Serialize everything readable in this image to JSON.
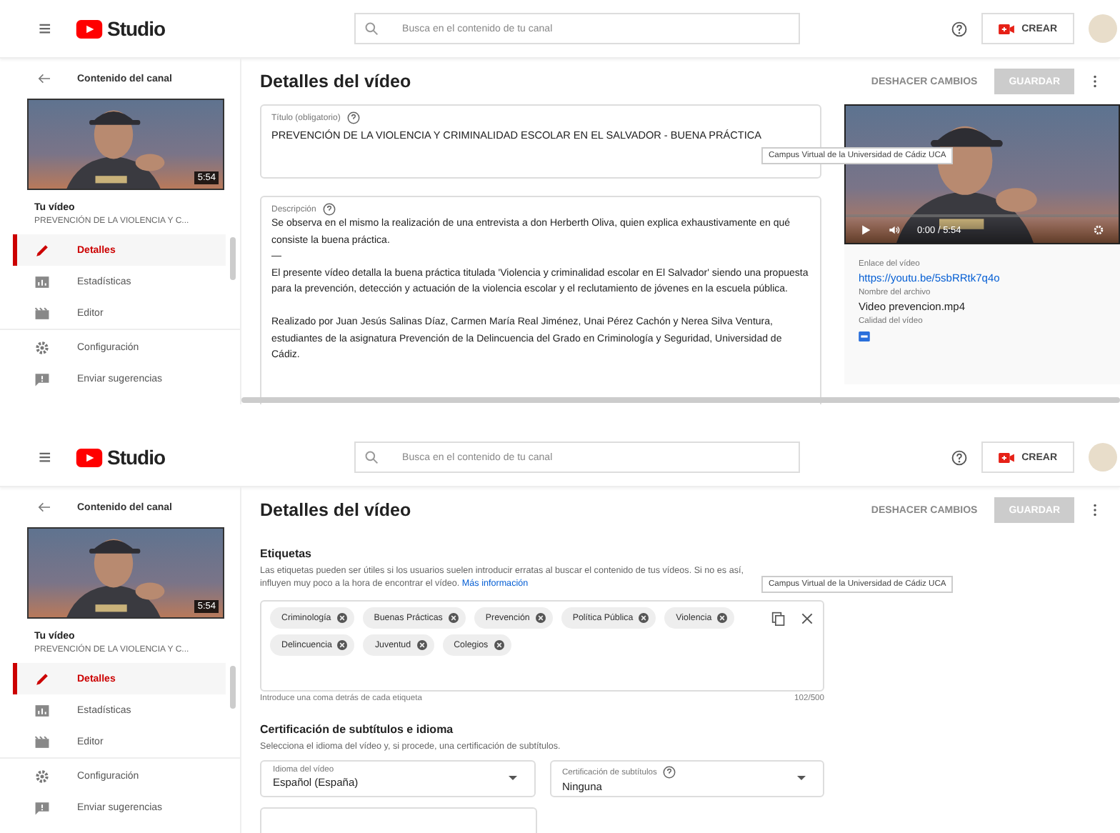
{
  "panels": [
    {
      "header": {
        "menu": "≡",
        "logo_text": "Studio",
        "search_placeholder": "Busca en el contenido de tu canal",
        "create_label": "CREAR"
      },
      "sidebar": {
        "back_label": "Contenido del canal",
        "duration": "5:54",
        "video_heading": "Tu vídeo",
        "video_title": "PREVENCIÓN DE LA VIOLENCIA Y C...",
        "items": [
          {
            "label": "Detalles",
            "selected": true
          },
          {
            "label": "Estadísticas",
            "selected": false
          },
          {
            "label": "Editor",
            "selected": false
          }
        ],
        "footer_items": [
          {
            "label": "Configuración",
            "selected": false
          },
          {
            "label": "Enviar sugerencias",
            "selected": false
          }
        ]
      },
      "toolbar": {
        "title": "Detalles del vídeo",
        "undo_label": "DESHACER CAMBIOS",
        "save_label": "GUARDAR",
        "save_disabled": true
      },
      "content": {
        "kind": "details",
        "title_field": {
          "label": "Título (obligatorio)",
          "value": "PREVENCIÓN DE LA VIOLENCIA Y CRIMINALIDAD ESCOLAR EN EL SALVADOR - BUENA PRÁCTICA"
        },
        "description_field": {
          "label": "Descripción",
          "paragraphs": [
            "Se observa en el mismo la realización de una entrevista a don Herberth Oliva, quien explica exhaustivamente en qué consiste la buena práctica.",
            "—",
            "El presente vídeo detalla la buena práctica titulada 'Violencia y criminalidad escolar en El Salvador' siendo una propuesta para la prevención, detección y actuación de la violencia escolar y el reclutamiento de jóvenes en la escuela pública.",
            "Realizado por Juan Jesús Salinas Díaz, Carmen María Real Jiménez, Unai Pérez Cachón y Nerea Silva Ventura, estudiantes de la asignatura Prevención de la Delincuencia del Grado en Criminología y Seguridad, Universidad de Cádiz."
          ]
        },
        "player": {
          "time": "0:00 / 5:54"
        },
        "info": [
          {
            "label": "Enlace del vídeo",
            "value": "https://youtu.be/5sbRRtk7q4o",
            "kind": "link"
          },
          {
            "label": "Nombre del archivo",
            "value": "Video prevencion.mp4",
            "kind": "text"
          },
          {
            "label": "Calidad del vídeo",
            "kind": "badge"
          }
        ]
      },
      "tooltip": "Campus Virtual de la Universidad de Cádiz UCA"
    },
    {
      "header": {
        "menu": "≡",
        "logo_text": "Studio",
        "search_placeholder": "Busca en el contenido de tu canal",
        "create_label": "CREAR"
      },
      "sidebar": {
        "back_label": "Contenido del canal",
        "duration": "5:54",
        "video_heading": "Tu vídeo",
        "video_title": "PREVENCIÓN DE LA VIOLENCIA Y C...",
        "items": [
          {
            "label": "Detalles",
            "selected": true
          },
          {
            "label": "Estadísticas",
            "selected": false
          },
          {
            "label": "Editor",
            "selected": false
          }
        ],
        "footer_items": [
          {
            "label": "Configuración",
            "selected": false
          },
          {
            "label": "Enviar sugerencias",
            "selected": false
          }
        ]
      },
      "toolbar": {
        "title": "Detalles del vídeo",
        "undo_label": "DESHACER CAMBIOS",
        "save_label": "GUARDAR",
        "save_disabled": true
      },
      "content": {
        "kind": "tags",
        "tags_heading": "Etiquetas",
        "tags_help": "Las etiquetas pueden ser útiles si los usuarios suelen introducir erratas al buscar el contenido de tus vídeos. Si no es así, influyen muy poco a la hora de encontrar el vídeo.",
        "tags_link": "Más información",
        "tags": [
          "Criminología",
          "Buenas Prácticas",
          "Prevención",
          "Política Pública",
          "Violencia",
          "Delincuencia",
          "Juventud",
          "Colegios"
        ],
        "tags_hint": "Introduce una coma detrás de cada etiqueta",
        "tags_count": "102/500",
        "subtitles_heading": "Certificación de subtítulos e idioma",
        "subtitles_help": "Selecciona el idioma del vídeo y, si procede, una certificación de subtítulos.",
        "selects": [
          {
            "label": "Idioma del vídeo",
            "value": "Español (España)",
            "help": false
          },
          {
            "label": "Certificación de subtítulos",
            "value": "Ninguna",
            "help": true
          }
        ]
      },
      "tooltip": "Campus Virtual de la Universidad de Cádiz UCA"
    }
  ]
}
